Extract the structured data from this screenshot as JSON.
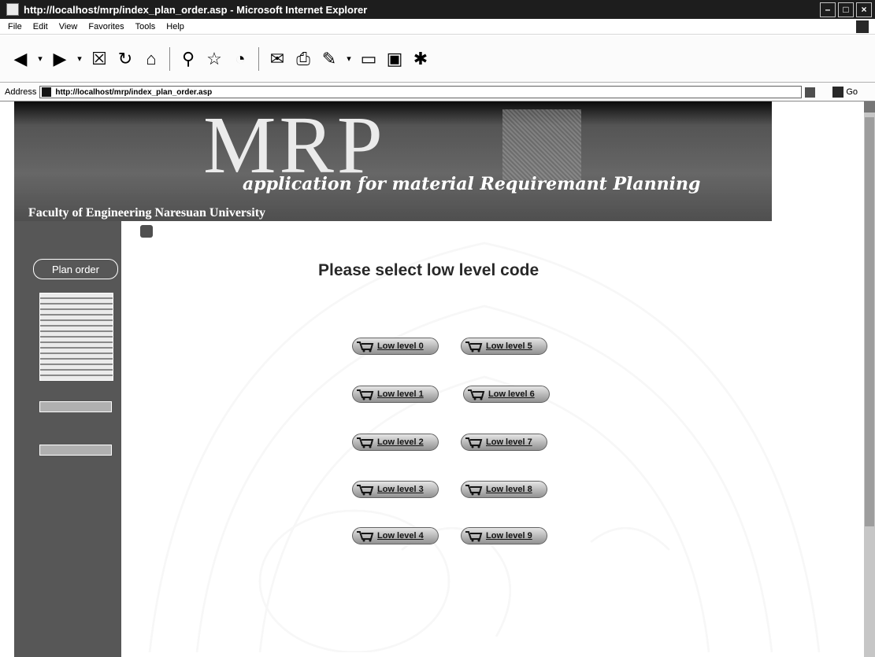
{
  "window": {
    "title": "http://localhost/mrp/index_plan_order.asp - Microsoft Internet Explorer"
  },
  "menu": [
    "File",
    "Edit",
    "View",
    "Favorites",
    "Tools",
    "Help"
  ],
  "address": {
    "label": "Address",
    "url": "http://localhost/mrp/index_plan_order.asp",
    "go": "Go"
  },
  "banner": {
    "logo": "MRP",
    "tagline": "application for material Requiremant Planning",
    "faculty": "Faculty of Engineering Naresuan University"
  },
  "sidebar": {
    "plan_order": "Plan order"
  },
  "main": {
    "heading": "Please select low level code"
  },
  "levels": [
    "Low level 0",
    "Low level 1",
    "Low level 2",
    "Low level 3",
    "Low level 4",
    "Low level 5",
    "Low level 6",
    "Low level 7",
    "Low level 8",
    "Low level 9"
  ]
}
